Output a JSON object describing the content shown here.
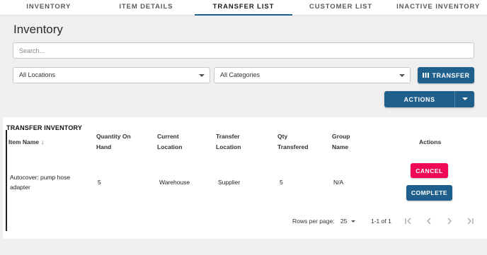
{
  "tabs": [
    {
      "label": "INVENTORY"
    },
    {
      "label": "ITEM DETAILS"
    },
    {
      "label": "TRANSFER LIST"
    },
    {
      "label": "CUSTOMER LIST"
    },
    {
      "label": "INACTIVE INVENTORY"
    }
  ],
  "active_tab": "TRANSFER LIST",
  "page": {
    "title": "Inventory"
  },
  "search": {
    "placeholder": "Search...",
    "value": ""
  },
  "filters": {
    "location": {
      "value": "All Locations"
    },
    "category": {
      "value": "All Categories"
    }
  },
  "buttons": {
    "transfer": "TRANSFER",
    "actions": "ACTIONS"
  },
  "panel": {
    "title": "TRANSFER INVENTORY"
  },
  "table": {
    "headers": {
      "item_name": "Item Name",
      "qty_on_hand_1": "Quantity On",
      "qty_on_hand_2": "Hand",
      "current_location_1": "Current",
      "current_location_2": "Location",
      "transfer_location_1": "Transfer",
      "transfer_location_2": "Location",
      "qty_transferred_1": "Qty",
      "qty_transferred_2": "Transfered",
      "group_name_1": "Group",
      "group_name_2": "Name",
      "actions": "Actions"
    },
    "rows": [
      {
        "item_name_line1": "Autocover: pump hose",
        "item_name_line2": "adapter",
        "qty_on_hand": "5",
        "current_location": "Warehouse",
        "transfer_location": "Supplier",
        "qty_transferred": "5",
        "group_name": "N/A",
        "cancel_label": "CANCEL",
        "complete_label": "COMPLETE"
      }
    ]
  },
  "pagination": {
    "rows_per_page_label": "Rows per page:",
    "rows_per_page": "25",
    "range": "1-1 of 1"
  },
  "colors": {
    "primary": "#1e5f8c",
    "danger": "#ef0a55",
    "background": "#efefef"
  }
}
